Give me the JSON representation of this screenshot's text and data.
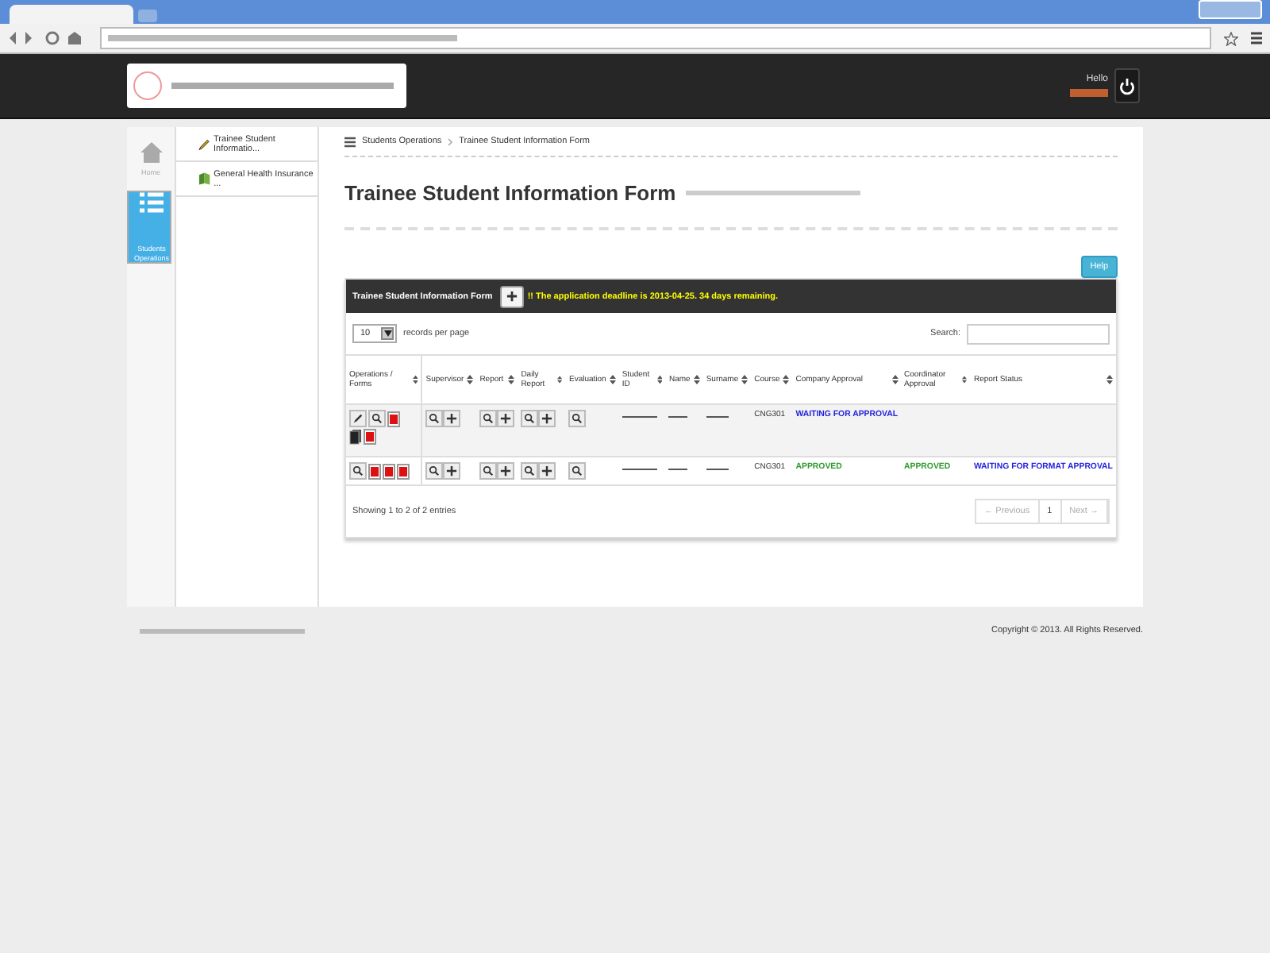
{
  "header": {
    "greeting": "Hello"
  },
  "nav": [
    {
      "label": "Home",
      "selected": false
    },
    {
      "label": "Students Operations",
      "selected": true
    }
  ],
  "submenu": [
    {
      "label": "Trainee Student Informatio..."
    },
    {
      "label": "General Health Insurance ..."
    }
  ],
  "breadcrumb": [
    "Students Operations",
    "Trainee Student Information Form"
  ],
  "page_title": "Trainee Student Information Form",
  "help_button": "Help",
  "panel": {
    "title": "Trainee Student Information Form",
    "notice": "!! The application deadline is 2013-04-25. 34 days remaining.",
    "page_length": "10",
    "length_label": "records per page",
    "search_label": "Search:",
    "columns": [
      "Operations / Forms",
      "Supervisor",
      "Report",
      "Daily Report",
      "Evaluation",
      "Student ID",
      "Name",
      "Surname",
      "Course",
      "Company Approval",
      "Coordinator Approval",
      "Report Status"
    ],
    "rows": [
      {
        "course": "CNG301",
        "company_approval": {
          "text": "WAITING FOR APPROVAL",
          "color": "#2222dd"
        }
      },
      {
        "course": "CNG301",
        "company_approval": {
          "text": "APPROVED",
          "color": "#2e9a2e"
        },
        "coordinator_approval": {
          "text": "APPROVED",
          "color": "#2e9a2e"
        },
        "report_status": {
          "text": "WAITING FOR FORMAT APPROVAL",
          "color": "#2222dd"
        }
      }
    ],
    "info": "Showing 1 to 2 of 2 entries",
    "pagination": [
      {
        "label": "← Previous",
        "disabled": true
      },
      {
        "label": "1",
        "disabled": false
      },
      {
        "label": "Next →",
        "disabled": true
      }
    ]
  },
  "footer": {
    "copyright": "Copyright © 2013. All Rights Reserved."
  }
}
